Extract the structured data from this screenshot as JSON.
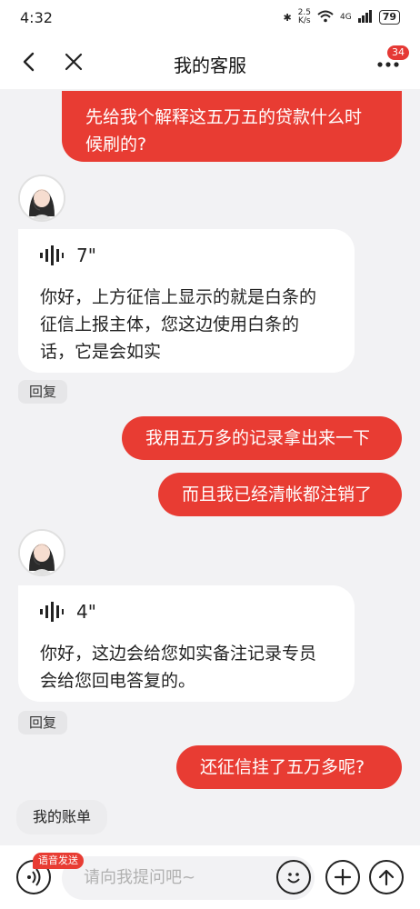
{
  "status": {
    "time": "4:32",
    "net_speed_top": "2.5",
    "net_speed_unit": "K/s",
    "signal_label": "4G",
    "battery": "79"
  },
  "nav": {
    "title": "我的客服",
    "badge_count": "34"
  },
  "messages": {
    "m1_line1": "先给我个解释这五万五的贷款什么时",
    "m1_line2": "候刷的?",
    "m2_duration": "7\"",
    "m2_line1": "你好，上方征信上显示的就是白条的",
    "m2_line2": "征信上报主体，您这边使用白条的",
    "m2_line3": "话，它是会如实",
    "m2_reply": "回复",
    "m3": "我用五万多的记录拿出来一下",
    "m4": "而且我已经清帐都注销了",
    "m5_duration": "4\"",
    "m5_line1": "你好，这边会给您如实备注记录专员",
    "m5_line2": "会给您回电答复的。",
    "m5_reply": "回复",
    "m6": "还征信挂了五万多呢?"
  },
  "quick_reply": "我的账单",
  "input": {
    "placeholder": "请向我提问吧~",
    "voice_tag": "语音发送"
  },
  "colors": {
    "accent": "#e83c33",
    "background": "#f2f2f4"
  },
  "icons": [
    "back-icon",
    "close-icon",
    "more-icon",
    "voice-wave-icon",
    "voice-mode-icon",
    "emoji-icon",
    "plus-icon",
    "send-icon"
  ]
}
